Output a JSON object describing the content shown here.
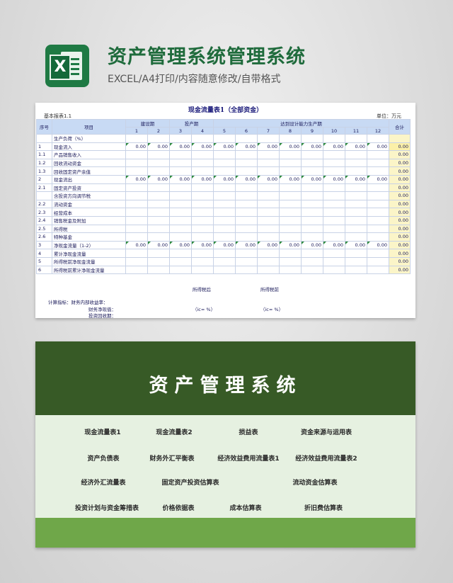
{
  "header": {
    "title": "资产管理系统管理系统",
    "subtitle": "EXCEL/A4打印/内容随意修改/自带格式",
    "logo_letter": "X"
  },
  "sheet": {
    "title": "现金流量表1（全部资金）",
    "report_no": "基本报表1.1",
    "unit": "单位：万元",
    "headers": {
      "seq": "序号",
      "item": "项目",
      "construction": "建设期",
      "commissioning": "投产期",
      "full_capacity": "达到设计能力生产期",
      "total": "合计",
      "periods": [
        "1",
        "2",
        "3",
        "4",
        "5",
        "6",
        "7",
        "8",
        "9",
        "10",
        "11",
        "12"
      ]
    },
    "rows": [
      {
        "no": "",
        "name": "生产负荷（%）",
        "values": false
      },
      {
        "no": "1",
        "name": "现金流入",
        "values": true
      },
      {
        "no": "1.1",
        "name": "产品销售收入",
        "values": false
      },
      {
        "no": "1.2",
        "name": "回收流动资金",
        "values": false
      },
      {
        "no": "1.3",
        "name": "回收固定资产余值",
        "values": false
      },
      {
        "no": "2",
        "name": "现金流出",
        "values": true
      },
      {
        "no": "2.1",
        "name": "固定资产投资",
        "values": false
      },
      {
        "no": "",
        "name": "含投资方向调节税",
        "values": false
      },
      {
        "no": "2.2",
        "name": "流动资金",
        "values": false
      },
      {
        "no": "2.3",
        "name": "经营成本",
        "values": false
      },
      {
        "no": "2.4",
        "name": "销售税金及附加",
        "values": false
      },
      {
        "no": "2.5",
        "name": "所得税",
        "values": false
      },
      {
        "no": "2.6",
        "name": "特种基金",
        "values": false
      },
      {
        "no": "3",
        "name": "净现金流量（1-2）",
        "values": true
      },
      {
        "no": "4",
        "name": "累计净现金流量",
        "values": false
      },
      {
        "no": "5",
        "name": "所得税前净现金流量",
        "values": false
      },
      {
        "no": "6",
        "name": "所得税前累计净现金流量",
        "values": false
      }
    ],
    "zero_value": "0.00",
    "indicators": {
      "after_tax": "所得税后",
      "before_tax": "所得税前",
      "label1": "计算指标：财务内部收益率：",
      "label2": "财务净现值：",
      "label3": "投资回收期：",
      "ic_after": "（ic=  %）",
      "ic_before": "（ic=  %）"
    }
  },
  "panel": {
    "title": "资产管理系统",
    "menu": [
      "现金流量表1",
      "现金流量表2",
      "损益表",
      "资金来源与运用表",
      "资产负债表",
      "财务外汇平衡表",
      "经济效益费用流量表1",
      "经济效益费用流量表2",
      "经济外汇流量表",
      "固定资产投资估算表",
      "流动资金估算表",
      "投资计划与资金筹措表",
      "价格依据表",
      "成本估算表",
      "折旧费估算表"
    ]
  }
}
